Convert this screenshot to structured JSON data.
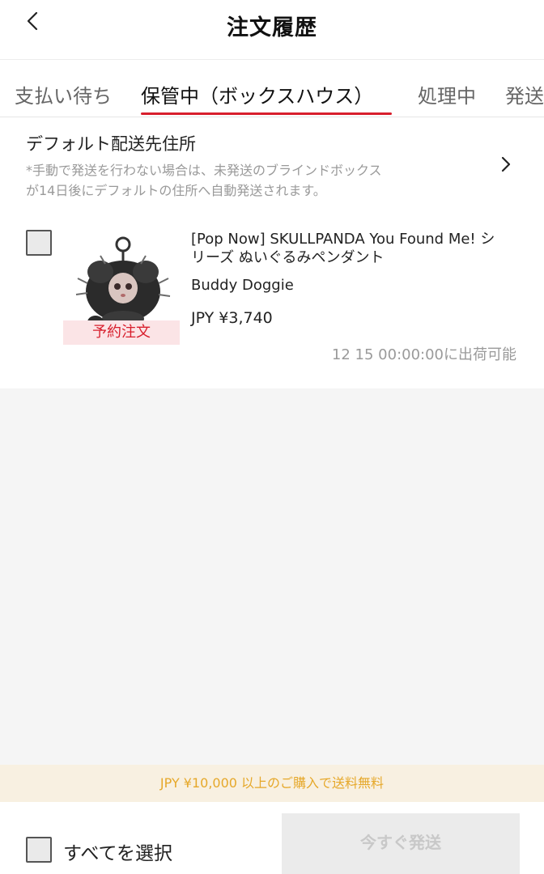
{
  "header": {
    "title": "注文履歴",
    "back_icon": "chevron-left-icon"
  },
  "tabs": [
    {
      "label": "支払い待ち"
    },
    {
      "label": "保管中（ボックスハウス）",
      "active": true
    },
    {
      "label": "処理中"
    },
    {
      "label": "発送"
    }
  ],
  "address": {
    "title": "デフォルト配送先住所",
    "note_line1": "*手動で発送を行わない場合は、未発送のブラインドボックス",
    "note_line2": "が14日後にデフォルトの住所へ自動発送されます。",
    "chevron_icon": "chevron-right-icon"
  },
  "item": {
    "checked": false,
    "badge": "予約注文",
    "name_line1": "[Pop Now] SKULLPANDA You Found Me! シ",
    "name_line2": "リーズ ぬいぐるみペンダント",
    "variant": "Buddy Doggie",
    "price": "JPY ¥3,740",
    "ship_date": "12 15 00:00:00に出荷可能"
  },
  "promo": {
    "text": "JPY ¥10,000 以上のご購入で送料無料"
  },
  "footer": {
    "select_all_label": "すべてを選択",
    "select_all_checked": false,
    "ship_now_label": "今すぐ発送"
  },
  "colors": {
    "accent": "#d81e2c",
    "promo_text": "#e6a82a",
    "promo_bg": "#f8f0e1",
    "muted_text": "#9a9a9a"
  }
}
